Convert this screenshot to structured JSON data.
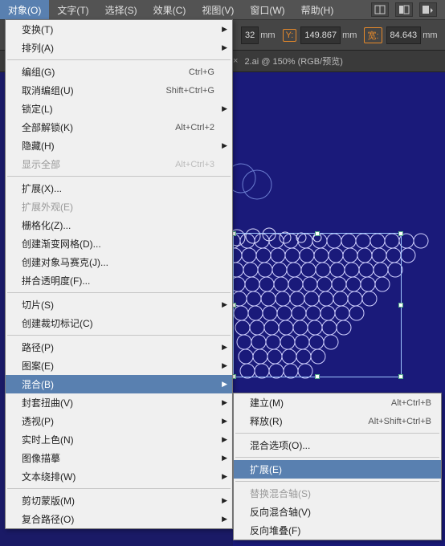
{
  "menubar": {
    "items": [
      "对象(O)",
      "文字(T)",
      "选择(S)",
      "效果(C)",
      "视图(V)",
      "窗口(W)",
      "帮助(H)"
    ],
    "active_index": 0
  },
  "toolbar": {
    "unit_suffix": "mm",
    "x_value": "32",
    "y_label": "Y:",
    "y_value": "149.867",
    "w_label": "宽:",
    "w_value": "84.643"
  },
  "tab": {
    "close": "×",
    "title": "2.ai @ 150% (RGB/预览)"
  },
  "dropdown": [
    {
      "type": "item",
      "label": "变换(T)",
      "submenu": true
    },
    {
      "type": "item",
      "label": "排列(A)",
      "submenu": true
    },
    {
      "type": "sep"
    },
    {
      "type": "item",
      "label": "编组(G)",
      "shortcut": "Ctrl+G"
    },
    {
      "type": "item",
      "label": "取消编组(U)",
      "shortcut": "Shift+Ctrl+G"
    },
    {
      "type": "item",
      "label": "锁定(L)",
      "submenu": true
    },
    {
      "type": "item",
      "label": "全部解锁(K)",
      "shortcut": "Alt+Ctrl+2"
    },
    {
      "type": "item",
      "label": "隐藏(H)",
      "submenu": true
    },
    {
      "type": "item",
      "label": "显示全部",
      "shortcut": "Alt+Ctrl+3",
      "disabled": true
    },
    {
      "type": "sep"
    },
    {
      "type": "item",
      "label": "扩展(X)..."
    },
    {
      "type": "item",
      "label": "扩展外观(E)",
      "disabled": true
    },
    {
      "type": "item",
      "label": "栅格化(Z)..."
    },
    {
      "type": "item",
      "label": "创建渐变网格(D)..."
    },
    {
      "type": "item",
      "label": "创建对象马赛克(J)..."
    },
    {
      "type": "item",
      "label": "拼合透明度(F)..."
    },
    {
      "type": "sep"
    },
    {
      "type": "item",
      "label": "切片(S)",
      "submenu": true
    },
    {
      "type": "item",
      "label": "创建裁切标记(C)"
    },
    {
      "type": "sep"
    },
    {
      "type": "item",
      "label": "路径(P)",
      "submenu": true
    },
    {
      "type": "item",
      "label": "图案(E)",
      "submenu": true
    },
    {
      "type": "item",
      "label": "混合(B)",
      "submenu": true,
      "highlighted": true
    },
    {
      "type": "item",
      "label": "封套扭曲(V)",
      "submenu": true
    },
    {
      "type": "item",
      "label": "透视(P)",
      "submenu": true
    },
    {
      "type": "item",
      "label": "实时上色(N)",
      "submenu": true
    },
    {
      "type": "item",
      "label": "图像描摹",
      "submenu": true
    },
    {
      "type": "item",
      "label": "文本绕排(W)",
      "submenu": true
    },
    {
      "type": "sep"
    },
    {
      "type": "item",
      "label": "剪切蒙版(M)",
      "submenu": true
    },
    {
      "type": "item",
      "label": "复合路径(O)",
      "submenu": true
    }
  ],
  "submenu": [
    {
      "type": "item",
      "label": "建立(M)",
      "shortcut": "Alt+Ctrl+B"
    },
    {
      "type": "item",
      "label": "释放(R)",
      "shortcut": "Alt+Shift+Ctrl+B"
    },
    {
      "type": "sep"
    },
    {
      "type": "item",
      "label": "混合选项(O)..."
    },
    {
      "type": "sep"
    },
    {
      "type": "item",
      "label": "扩展(E)",
      "highlighted": true
    },
    {
      "type": "sep"
    },
    {
      "type": "item",
      "label": "替换混合轴(S)",
      "disabled": true
    },
    {
      "type": "item",
      "label": "反向混合轴(V)"
    },
    {
      "type": "item",
      "label": "反向堆叠(F)"
    }
  ]
}
